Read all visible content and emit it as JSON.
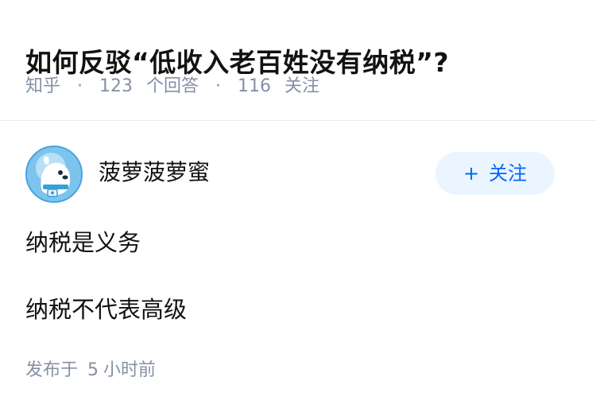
{
  "question": {
    "title": "如何反驳“低收入老百姓没有纳税”?",
    "source": "知乎",
    "separator": "·",
    "answers_count": "123",
    "answers_label": "个回答",
    "followers_count": "116",
    "followers_label": "关注"
  },
  "answer": {
    "author_name": "菠萝菠萝蜜",
    "avatar_icon": "penguin-astronaut-avatar",
    "follow_button": {
      "icon": "plus-icon",
      "icon_glyph": "+",
      "label": "关注"
    },
    "paragraphs": [
      "纳税是义务",
      "纳税不代表高级"
    ],
    "time_prefix": "发布于",
    "time_number": "5",
    "time_suffix": "小时前"
  },
  "colors": {
    "text_primary": "#121212",
    "text_secondary": "#8590a6",
    "brand_blue": "#0066ff",
    "button_bg": "#ebf5ff",
    "divider": "#ebebeb",
    "avatar_bg": "#7cc4ee"
  }
}
